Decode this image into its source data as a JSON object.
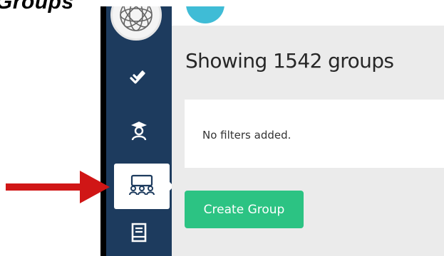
{
  "page": {
    "title": "Groups"
  },
  "main": {
    "heading": "Showing 1542 groups",
    "filters_text": "No filters added.",
    "create_button_label": "Create Group"
  },
  "sidebar": {
    "items": [
      {
        "icon": "checkmarks-icon"
      },
      {
        "icon": "student-icon"
      },
      {
        "icon": "groups-icon",
        "active": true
      },
      {
        "icon": "book-icon"
      }
    ]
  },
  "colors": {
    "sidebar": "#1d3b5e",
    "accent_green": "#2cc383",
    "avatar_teal": "#3fbcd6",
    "arrow_red": "#d01616",
    "background": "#ebebeb"
  }
}
